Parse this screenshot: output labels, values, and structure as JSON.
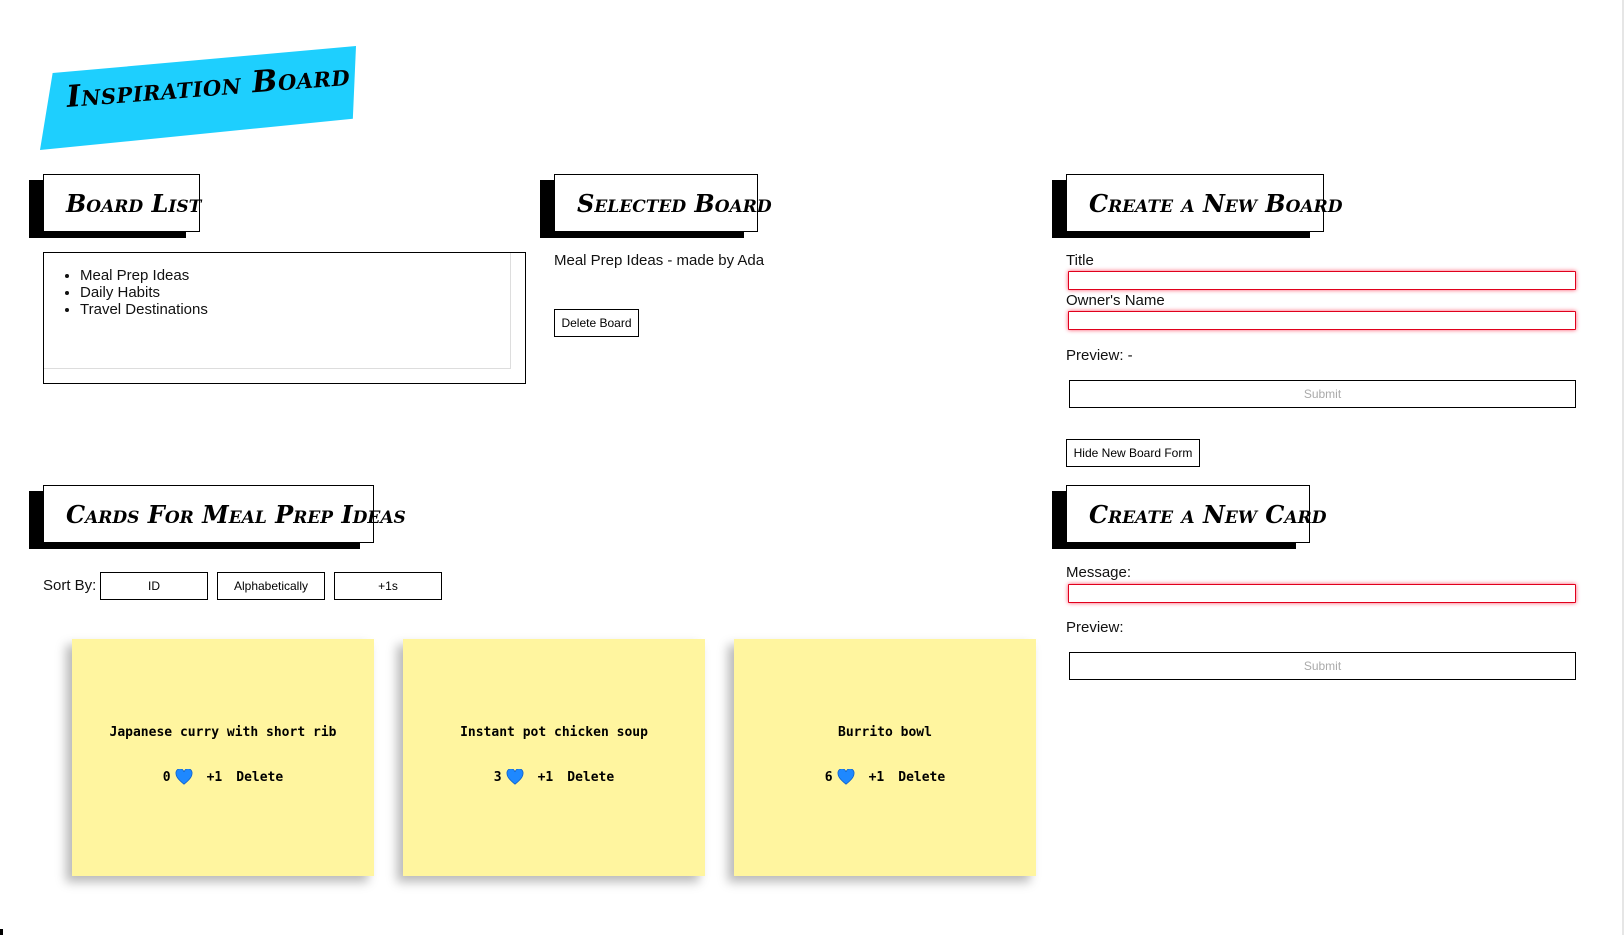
{
  "app": {
    "title": "Inspiration Board",
    "banner_color": "#1ecffe"
  },
  "board_list": {
    "heading": "Board List",
    "items": [
      "Meal Prep Ideas",
      "Daily Habits",
      "Travel Destinations"
    ]
  },
  "selected_board": {
    "heading": "Selected Board",
    "summary": "Meal Prep Ideas - made by Ada",
    "delete_label": "Delete Board"
  },
  "new_board_form": {
    "heading": "Create a New Board",
    "title_label": "Title",
    "title_value": "",
    "owner_label": "Owner's Name",
    "owner_value": "",
    "preview_label": "Preview: -",
    "submit_label": "Submit",
    "hide_label": "Hide New Board Form"
  },
  "cards_section": {
    "heading": "Cards For Meal Prep Ideas",
    "sort_label": "Sort By:",
    "sort_options": [
      "ID",
      "Alphabetically",
      "+1s"
    ],
    "cards": [
      {
        "message": "Japanese curry with short rib",
        "likes": "0",
        "plus_label": "+1",
        "delete_label": "Delete"
      },
      {
        "message": "Instant pot chicken soup",
        "likes": "3",
        "plus_label": "+1",
        "delete_label": "Delete"
      },
      {
        "message": "Burrito bowl",
        "likes": "6",
        "plus_label": "+1",
        "delete_label": "Delete"
      }
    ],
    "card_color": "#fff59f",
    "heart_icon": "blue-heart-icon",
    "heart_color": "#1e88ff"
  },
  "new_card_form": {
    "heading": "Create a New Card",
    "message_label": "Message:",
    "message_value": "",
    "preview_label": "Preview:",
    "submit_label": "Submit"
  },
  "colors": {
    "invalid_border": "#e0001c"
  }
}
